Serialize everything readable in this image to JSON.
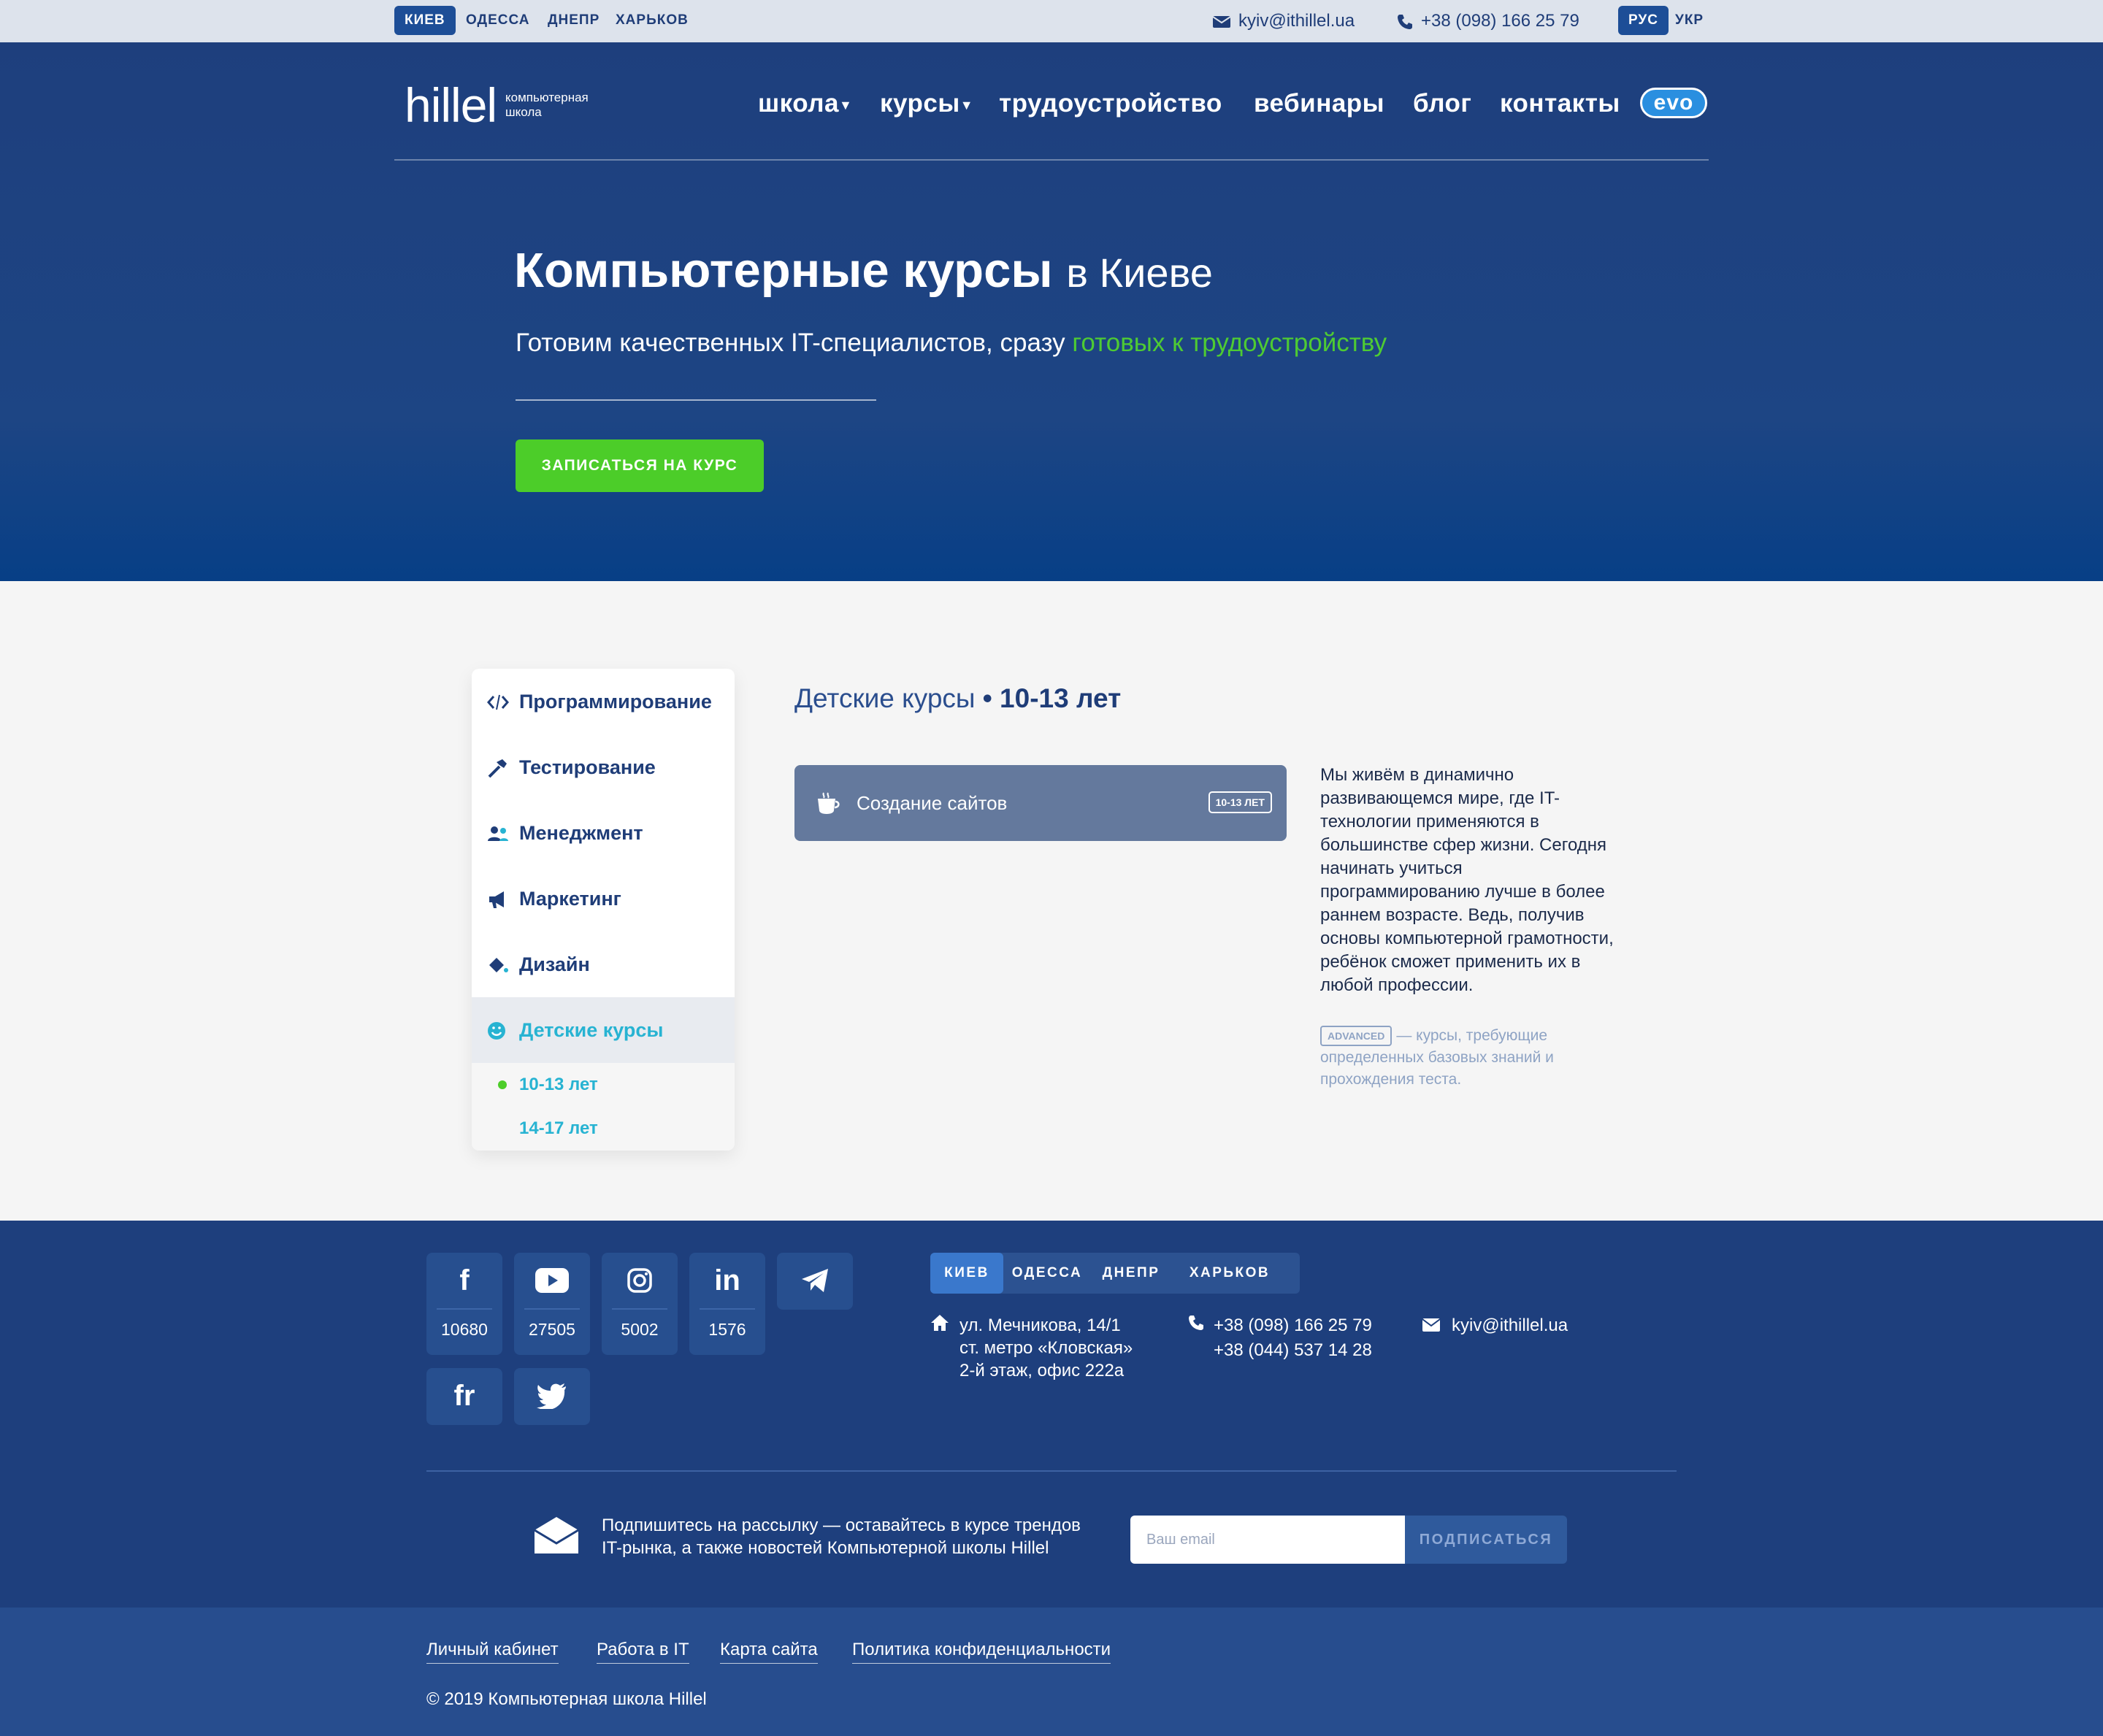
{
  "topbar": {
    "cities": [
      "КИЕВ",
      "ОДЕССА",
      "ДНЕПР",
      "ХАРЬКОВ"
    ],
    "email": "kyiv@ithillel.ua",
    "phone": "+38 (098) 166 25 79",
    "languages": [
      "РУС",
      "УКР"
    ]
  },
  "header": {
    "logo_word": "hillel",
    "logo_sub": "компьютерная школа",
    "nav": [
      "школа",
      "курсы",
      "трудоустройство",
      "вебинары",
      "блог",
      "контакты"
    ],
    "evo": "evo"
  },
  "hero": {
    "title_bold": "Компьютерные курсы",
    "title_light": "в Киеве",
    "subtitle_plain": "Готовим качественных IT-специалистов, сразу",
    "subtitle_accent": "готовых к трудоустройству",
    "cta": "ЗАПИСАТЬСЯ НА КУРС"
  },
  "sidebar": {
    "items": [
      "Программирование",
      "Тестирование",
      "Менеджмент",
      "Маркетинг",
      "Дизайн",
      "Детские курсы"
    ],
    "subitems": [
      "10-13 лет",
      "14-17 лет"
    ]
  },
  "main": {
    "title": "Детские курсы",
    "title_separator": "•",
    "title_age": "10-13 лет",
    "course_name": "Создание сайтов",
    "course_badge": "10-13 ЛЕТ",
    "description": "Мы живём в динамично развивающемся мире, где IT-технологии применяются в большинстве сфер жизни. Сегодня начинать учиться программированию лучше в более раннем возрасте. Ведь, получив основы компьютерной грамотности, ребёнок сможет применить их в любой профессии.",
    "note_badge": "ADVANCED",
    "note_text": "— курсы, требующие определенных базовых знаний и прохождения теста."
  },
  "footer": {
    "social": [
      {
        "icon": "facebook-icon",
        "glyph": "f",
        "count": "10680"
      },
      {
        "icon": "youtube-icon",
        "glyph": "▶",
        "count": "27505"
      },
      {
        "icon": "instagram-icon",
        "glyph": "◎",
        "count": "5002"
      },
      {
        "icon": "linkedin-icon",
        "glyph": "in",
        "count": "1576"
      },
      {
        "icon": "telegram-icon",
        "glyph": "➤"
      },
      {
        "icon": "freelance-icon",
        "glyph": "fr"
      },
      {
        "icon": "twitter-icon",
        "glyph": "🐦"
      }
    ],
    "cities": [
      "КИЕВ",
      "ОДЕССА",
      "ДНЕПР",
      "ХАРЬКОВ"
    ],
    "address": [
      "ул. Мечникова, 14/1",
      "ст. метро «Кловская»",
      "2-й этаж, офис 222а"
    ],
    "phones": [
      "+38 (098) 166 25 79",
      "+38 (044) 537 14 28"
    ],
    "email": "kyiv@ithillel.ua",
    "subscribe_text": [
      "Подпишитесь на рассылку — оставайтесь в курсе трендов",
      "IT-рынка, а также новостей Компьютерной школы Hillel"
    ],
    "email_placeholder": "Ваш email",
    "subscribe_button": "ПОДПИСАТЬСЯ",
    "links": [
      "Личный кабинет",
      "Работа в IT",
      "Карта сайта",
      "Политика конфиденциальности"
    ],
    "copyright": "© 2019 Компьютерная школа Hillel"
  },
  "colors": {
    "brand_blue": "#1e3f7d",
    "accent_green": "#4ccd29",
    "accent_cyan": "#27b3d2"
  }
}
